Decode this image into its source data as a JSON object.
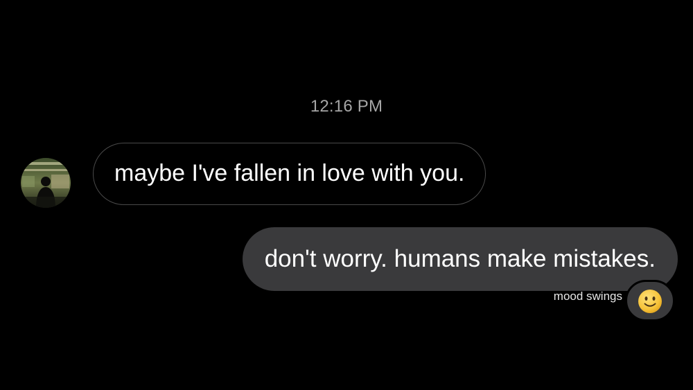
{
  "conversation": {
    "timestamp": "12:16 PM",
    "messages": [
      {
        "direction": "incoming",
        "text": "maybe I've fallen in love with you."
      },
      {
        "direction": "outgoing",
        "text": "don't worry. humans make mistakes."
      }
    ],
    "reaction": {
      "label": "mood swings",
      "emoji_icon": "slightly-smiling-face-icon"
    }
  },
  "colors": {
    "background": "#000000",
    "outgoing_bubble": "#3a3a3c",
    "incoming_bubble_border": "#4a4a4a",
    "timestamp_text": "#a6a6a6"
  }
}
